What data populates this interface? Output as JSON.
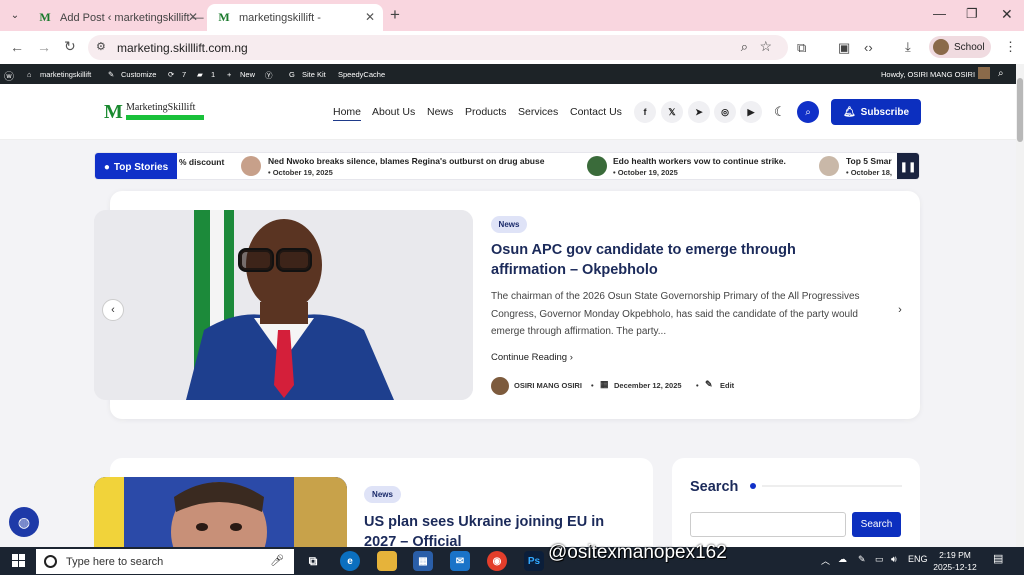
{
  "browser": {
    "tabs": [
      {
        "title": "Add Post ‹ marketingskillift —",
        "active": false
      },
      {
        "title": "marketingskillift -",
        "active": true
      }
    ],
    "url": "marketing.skilllift.com.ng",
    "profile_label": "School"
  },
  "wp_admin_bar": {
    "site": "marketingskillift",
    "customize": "Customize",
    "updates_count": "7",
    "comments_count": "1",
    "new": "New",
    "site_kit": "Site Kit",
    "speedycache": "SpeedyCache",
    "greeting": "Howdy, OSIRI MANG OSIRI"
  },
  "site": {
    "logo_text": "MarketingSkillift",
    "nav": [
      "Home",
      "About Us",
      "News",
      "Products",
      "Services",
      "Contact Us"
    ],
    "social_icons": [
      "facebook-icon",
      "x-icon",
      "telegram-icon",
      "instagram-icon",
      "youtube-icon"
    ],
    "subscribe_label": "Subscribe"
  },
  "ticker": {
    "label": "Top Stories",
    "items": [
      {
        "title": "% discount",
        "date": ""
      },
      {
        "title": "Ned Nwoko breaks silence, blames Regina's outburst on drug abuse",
        "date": "• October 19, 2025"
      },
      {
        "title": "Edo health workers vow to continue strike.",
        "date": "• October 19, 2025"
      },
      {
        "title": "Top 5 Smar",
        "date": "• October 18,"
      }
    ]
  },
  "hero": {
    "category": "News",
    "title": "Osun APC gov candidate to emerge through affirmation – Okpebholo",
    "excerpt": "The chairman of the 2026 Osun State Governorship Primary of the All Progressives Congress, Governor Monday Okpebholo, has said the candidate of the party would emerge through affirmation. The party...",
    "continue_label": "Continue Reading",
    "author": "OSIRI MANG OSIRI",
    "date": "December 12, 2025",
    "edit_label": "Edit"
  },
  "card2": {
    "category": "News",
    "title": "US plan sees Ukraine joining EU in 2027 – Official"
  },
  "sidebar": {
    "search_title": "Search",
    "search_button": "Search"
  },
  "taskbar": {
    "search_placeholder": "Type here to search",
    "watermark": "@ositexmanopex162",
    "language": "ENG",
    "time": "2:19 PM",
    "date": "2025-12-12"
  }
}
